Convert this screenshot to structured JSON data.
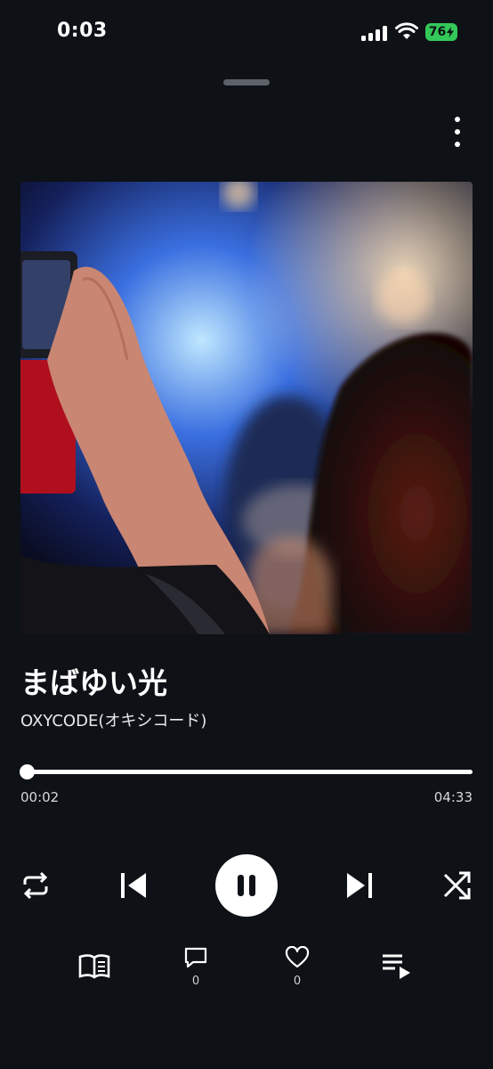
{
  "status_bar": {
    "time": "0:03",
    "battery": "76"
  },
  "track": {
    "title": "まばゆい光",
    "artist": "OXYCODE(オキシコード)"
  },
  "playback": {
    "elapsed": "00:02",
    "total": "04:33",
    "progress_fraction": 0.007,
    "state": "playing"
  },
  "controls": {
    "icons": [
      "repeat-icon",
      "previous-icon",
      "pause-icon",
      "next-icon",
      "shuffle-icon"
    ]
  },
  "bottom_bar": {
    "comments_count": "0",
    "likes_count": "0",
    "icons": [
      "lyrics-book-icon",
      "comment-icon",
      "heart-icon",
      "queue-icon"
    ]
  },
  "colors": {
    "background": "#0e1116",
    "battery": "#34c759",
    "grabber": "#5d6168"
  }
}
